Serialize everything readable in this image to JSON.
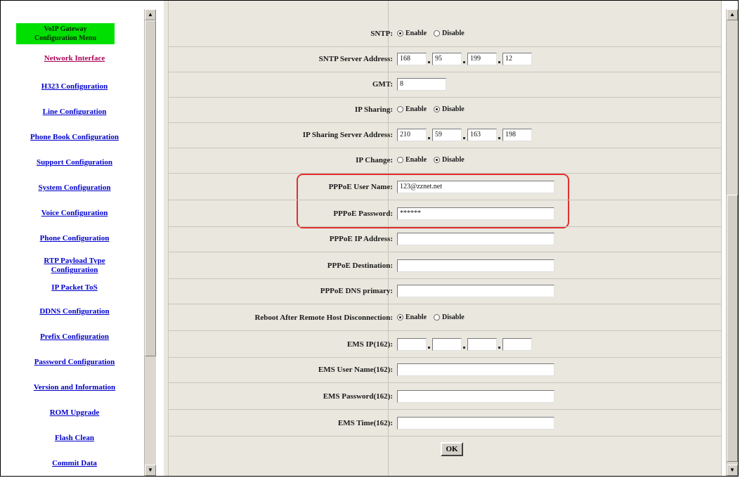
{
  "window": {
    "accent_color": "#00e000",
    "highlight_color": "#e0302e"
  },
  "menu": {
    "header": [
      "VoIP Gateway",
      "Configuration Menu"
    ],
    "items": [
      {
        "label": "Network Interface",
        "visited": true
      },
      {
        "label": "H323 Configuration"
      },
      {
        "label": "Line Configuration"
      },
      {
        "label": "Phone Book Configuration"
      },
      {
        "label": "Support Configuration"
      },
      {
        "label": "System Configuration"
      },
      {
        "label": "Voice Configuration"
      },
      {
        "label": "Phone Configuration"
      },
      {
        "label": "RTP Payload Type",
        "label2": "Configuration"
      },
      {
        "label": "IP Packet ToS"
      },
      {
        "label": "DDNS Configuration"
      },
      {
        "label": "Prefix Configuration"
      },
      {
        "label": "Password Configuration"
      },
      {
        "label": "Version and Information"
      },
      {
        "label": "ROM Upgrade"
      },
      {
        "label": "Flash Clean"
      },
      {
        "label": "Commit Data"
      }
    ]
  },
  "form": {
    "rows": [
      {
        "label": "SNTP:",
        "type": "radio",
        "options": [
          "Enable",
          "Disable"
        ],
        "selected": 0
      },
      {
        "label": "SNTP Server Address:",
        "type": "ip",
        "values": [
          "168",
          "95",
          "199",
          "12"
        ]
      },
      {
        "label": "GMT:",
        "type": "text",
        "value": "8",
        "width": "short"
      },
      {
        "label": "IP Sharing:",
        "type": "radio",
        "options": [
          "Enable",
          "Disable"
        ],
        "selected": 1
      },
      {
        "label": "IP Sharing Server Address:",
        "type": "ip",
        "values": [
          "210",
          "59",
          "163",
          "198"
        ]
      },
      {
        "label": "IP Change:",
        "type": "radio",
        "options": [
          "Enable",
          "Disable"
        ],
        "selected": 1
      },
      {
        "label": "PPPoE User Name:",
        "type": "text",
        "value": "123@zznet.net"
      },
      {
        "label": "PPPoE Password:",
        "type": "text",
        "value": "******"
      },
      {
        "label": "PPPoE IP Address:",
        "type": "text",
        "value": ""
      },
      {
        "label": "PPPoE Destination:",
        "type": "text",
        "value": ""
      },
      {
        "label": "PPPoE DNS primary:",
        "type": "text",
        "value": ""
      },
      {
        "label": "Reboot After Remote Host Disconnection:",
        "type": "radio",
        "options": [
          "Enable",
          "Disable"
        ],
        "selected": 0
      },
      {
        "label": "EMS IP(162):",
        "type": "ip",
        "values": [
          "",
          "",
          "",
          ""
        ]
      },
      {
        "label": "EMS User Name(162):",
        "type": "text",
        "value": ""
      },
      {
        "label": "EMS Password(162):",
        "type": "text",
        "value": ""
      },
      {
        "label": "EMS Time(162):",
        "type": "text",
        "value": ""
      }
    ],
    "ok_label": "OK"
  }
}
